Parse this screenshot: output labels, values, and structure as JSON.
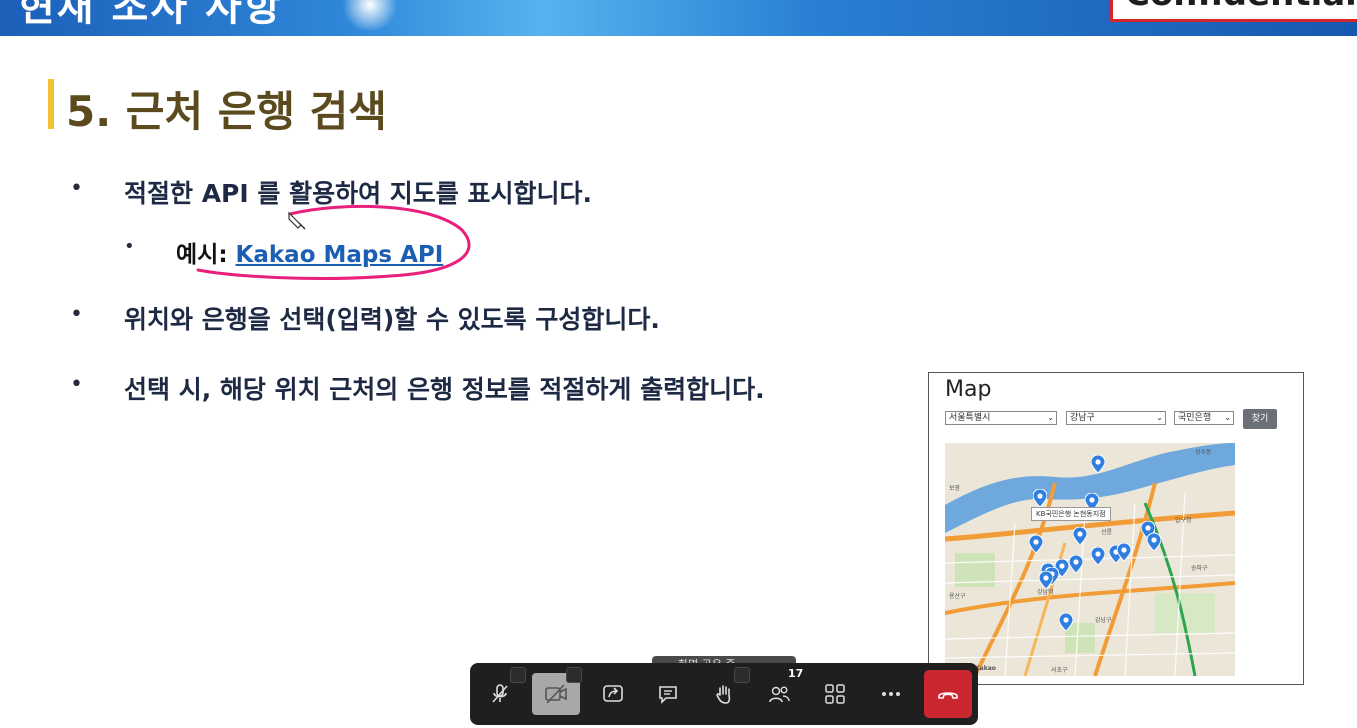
{
  "banner": {
    "title_fragment": "현재 조사 사항",
    "confidential_label": "Confidential"
  },
  "slide": {
    "heading": "5. 근처 은행 검색",
    "bullets": [
      "적절한 API 를 활용하여 지도를 표시합니다.",
      "위치와 은행을 선택(입력)할 수 있도록 구성합니다.",
      "선택 시, 해당 위치 근처의 은행 정보를 적절하게 출력합니다."
    ],
    "sub_bullet_prefix": "예시: ",
    "sub_bullet_link": "Kakao Maps API",
    "bullet_glyph": "•"
  },
  "map_widget": {
    "title": "Map",
    "city_select": "서울특별시",
    "district_select": "강남구",
    "bank_select": "국민은행",
    "find_button": "찾기",
    "tooltip": "KB국민은행 논현동지점",
    "labels": [
      "보광",
      "용산구",
      "강남구",
      "서초구",
      "강남역",
      "송파구",
      "선릉",
      "압구정",
      "성수동",
      "Kakao"
    ],
    "marker_color": "#2f7fe0"
  },
  "meeting": {
    "share_tooltip": "화면 공유 중",
    "participants_count": "17",
    "end_call_color": "#c9262f"
  },
  "icons": {
    "mic": "mic-muted-icon",
    "camera": "camera-off-icon",
    "share": "share-screen-icon",
    "chat": "chat-icon",
    "raise_hand": "raise-hand-icon",
    "participants": "participants-icon",
    "apps": "apps-grid-icon",
    "more": "more-icon",
    "leave": "leave-call-icon"
  }
}
